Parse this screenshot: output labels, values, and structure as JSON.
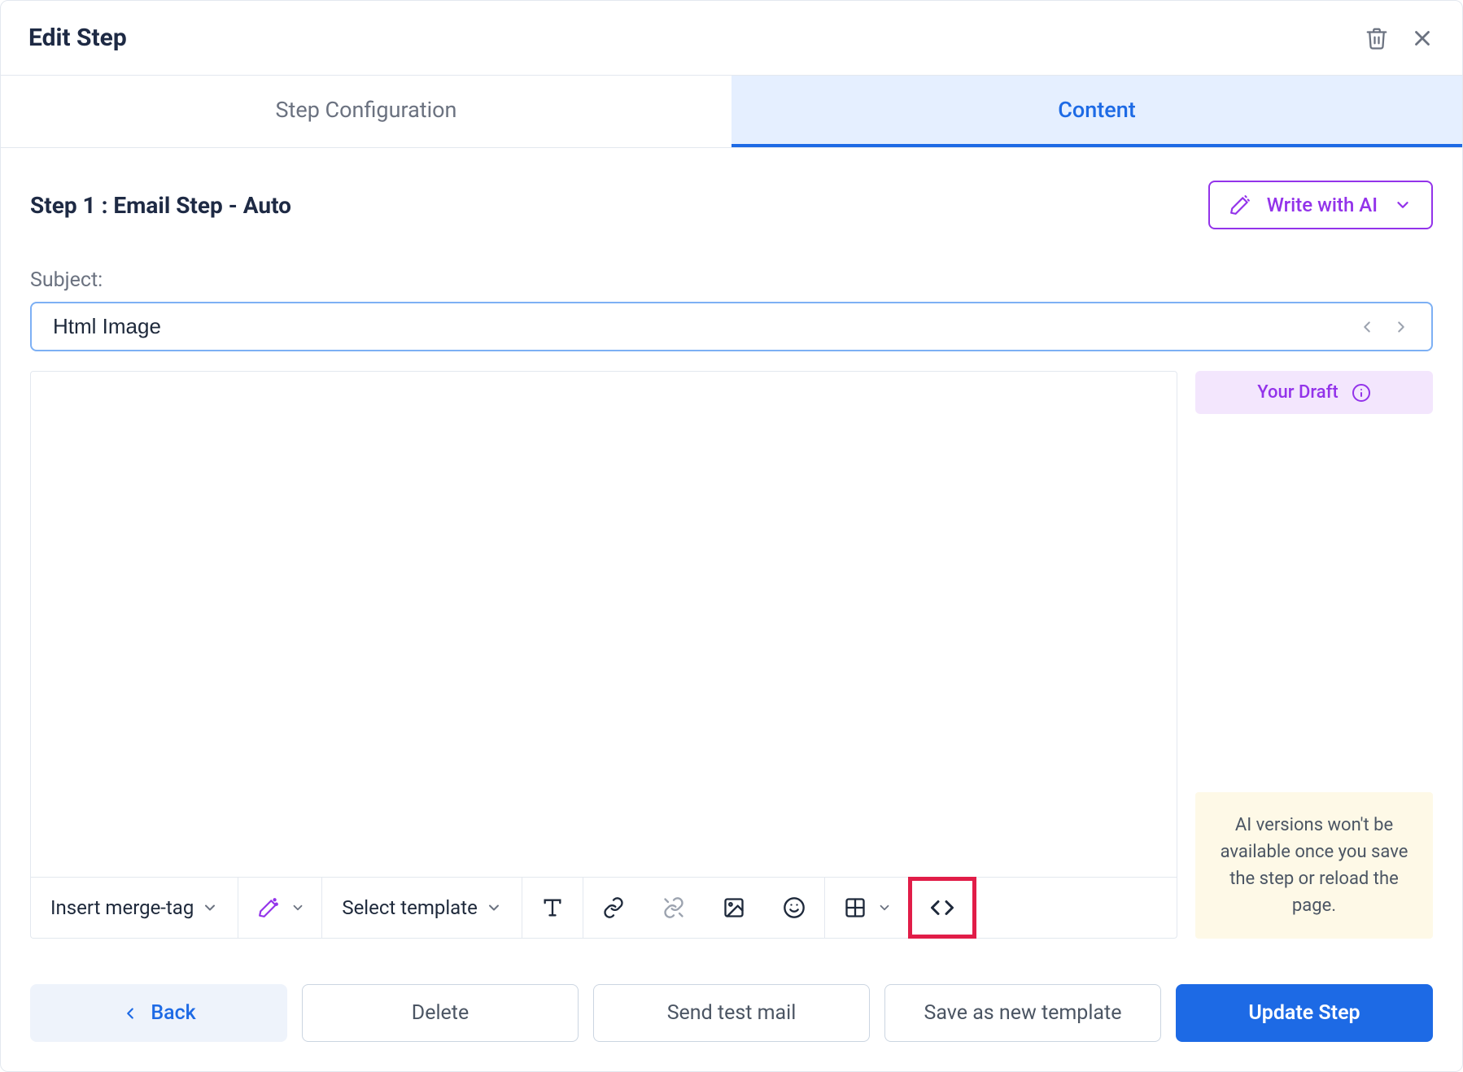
{
  "header": {
    "title": "Edit Step"
  },
  "tabs": {
    "config": "Step Configuration",
    "content": "Content"
  },
  "step": {
    "prefix": "Step 1 : ",
    "name": "Email Step - Auto"
  },
  "ai_button": "Write with AI",
  "subject": {
    "label": "Subject:",
    "value": "Html Image"
  },
  "toolbar": {
    "merge_tag": "Insert merge-tag",
    "select_template": "Select template"
  },
  "side": {
    "draft": "Your Draft",
    "warn": "AI versions won't be available once you save the step or reload the page."
  },
  "footer": {
    "back": "Back",
    "delete": "Delete",
    "send_test": "Send test mail",
    "save_template": "Save as new template",
    "update": "Update Step"
  }
}
